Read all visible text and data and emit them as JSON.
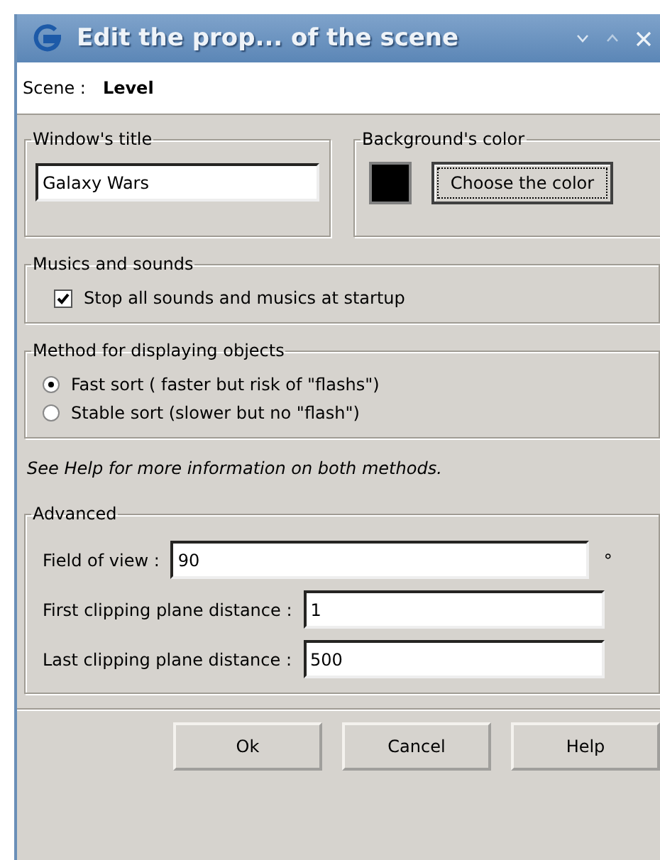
{
  "window": {
    "title": "Edit the prop... of the scene"
  },
  "scene": {
    "label": "Scene :",
    "name": "Level"
  },
  "window_title_group": {
    "legend": "Window's title",
    "value": "Galaxy Wars"
  },
  "background_group": {
    "legend": "Background's color",
    "color": "#000000",
    "button": "Choose the color"
  },
  "sounds_group": {
    "legend": "Musics and sounds",
    "checkbox": {
      "label": "Stop all sounds and musics at startup",
      "checked": true
    }
  },
  "display_group": {
    "legend": "Method for displaying objects",
    "options": [
      {
        "label": "Fast sort ( faster but risk of \"flashs\")",
        "selected": true
      },
      {
        "label": "Stable sort (slower but no \"flash\")",
        "selected": false
      }
    ]
  },
  "help_note": "See Help for more information on both methods.",
  "advanced_group": {
    "legend": "Advanced",
    "fields": [
      {
        "label": "Field of view :",
        "value": "90",
        "unit": "°"
      },
      {
        "label": "First clipping plane distance :",
        "value": "1"
      },
      {
        "label": "Last clipping plane distance :",
        "value": "500"
      }
    ]
  },
  "buttons": [
    "Ok",
    "Cancel",
    "Help"
  ]
}
